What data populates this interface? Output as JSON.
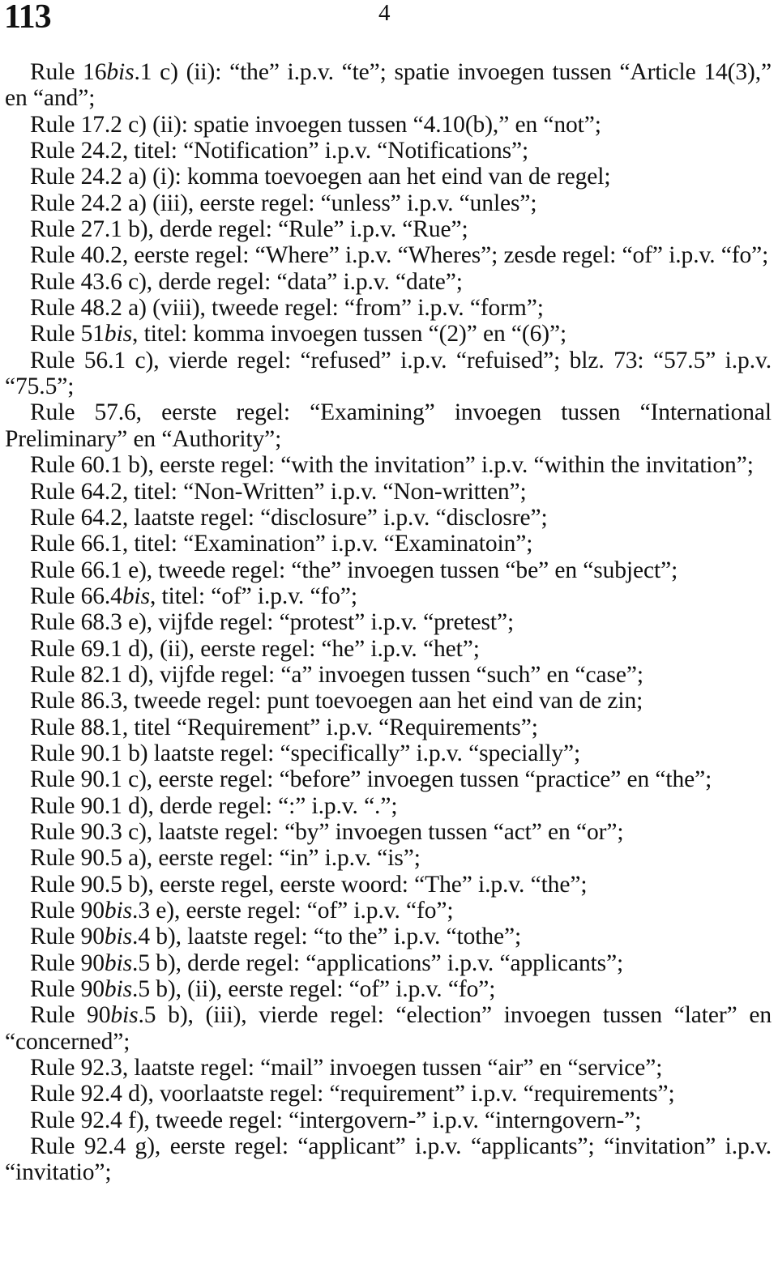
{
  "header": {
    "document_number": "113",
    "page_number": "4"
  },
  "errata": [
    {
      "rule": "Rule 16",
      "rule_bis": "bis",
      "rule_tail": ".1 c) (ii): “the” i.p.v. “te”; spatie invoegen tussen “Article 14(3),” en “and”;"
    },
    {
      "rule": "Rule 17.2 c) (ii): spatie invoegen tussen “4.10(b),” en “not”;"
    },
    {
      "rule": "Rule 24.2, titel: “Notification” i.p.v. “Notifications”;"
    },
    {
      "rule": "Rule 24.2 a) (i): komma toevoegen aan het eind van de regel;"
    },
    {
      "rule": "Rule 24.2 a) (iii), eerste regel: “unless” i.p.v. “unles”;"
    },
    {
      "rule": "Rule 27.1 b), derde regel: “Rule” i.p.v. “Rue”;"
    },
    {
      "rule": "Rule 40.2, eerste regel: “Where” i.p.v. “Wheres”; zesde regel: “of” i.p.v. “fo”;"
    },
    {
      "rule": "Rule 43.6 c), derde regel: “data” i.p.v. “date”;"
    },
    {
      "rule": "Rule 48.2 a) (viii), tweede regel: “from” i.p.v. “form”;"
    },
    {
      "rule": "Rule 51",
      "rule_bis": "bis",
      "rule_tail": ", titel: komma invoegen tussen “(2)” en “(6)”;"
    },
    {
      "rule": "Rule 56.1 c), vierde regel: “refused” i.p.v. “refuised”; blz. 73: “57.5” i.p.v. “75.5”;"
    },
    {
      "rule": "Rule 57.6, eerste regel: “Examining” invoegen tussen “International Preliminary” en “Authority”;"
    },
    {
      "rule": "Rule 60.1 b), eerste regel: “with the invitation” i.p.v. “within the invi­tation”;"
    },
    {
      "rule": "Rule 64.2, titel: “Non-Written” i.p.v. “Non-written”;"
    },
    {
      "rule": "Rule 64.2, laatste regel: “disclosure” i.p.v. “disclosre”;"
    },
    {
      "rule": "Rule 66.1, titel: “Examination” i.p.v. “Examinatoin”;"
    },
    {
      "rule": "Rule 66.1 e), tweede regel: “the” invoegen tussen “be” en “subject”;"
    },
    {
      "rule": "Rule 66.4",
      "rule_bis": "bis",
      "rule_tail": ", titel: “of” i.p.v. “fo”;"
    },
    {
      "rule": "Rule 68.3 e), vijfde regel: “protest” i.p.v. “pretest”;"
    },
    {
      "rule": "Rule 69.1 d), (ii), eerste regel: “he” i.p.v. “het”;"
    },
    {
      "rule": "Rule 82.1 d), vijfde regel: “a” invoegen tussen “such” en “case”;"
    },
    {
      "rule": "Rule 86.3, tweede regel: punt toevoegen aan het eind van de zin;"
    },
    {
      "rule": "Rule 88.1, titel “Requirement” i.p.v. “Requirements”;"
    },
    {
      "rule": "Rule 90.1 b) laatste regel: “specifically” i.p.v. “specially”;"
    },
    {
      "rule": "Rule 90.1 c), eerste regel: “before” invoegen tussen “practice” en “the”;"
    },
    {
      "rule": "Rule 90.1 d), derde regel: “:” i.p.v. “.”;"
    },
    {
      "rule": "Rule 90.3 c), laatste regel: “by” invoegen tussen “act” en “or”;"
    },
    {
      "rule": "Rule 90.5 a), eerste regel: “in” i.p.v. “is”;"
    },
    {
      "rule": "Rule 90.5 b), eerste regel, eerste woord: “The” i.p.v. “the”;"
    },
    {
      "rule": "Rule 90",
      "rule_bis": "bis",
      "rule_tail": ".3 e), eerste regel: “of” i.p.v. “fo”;"
    },
    {
      "rule": "Rule 90",
      "rule_bis": "bis",
      "rule_tail": ".4 b), laatste regel: “to the” i.p.v. “tothe”;"
    },
    {
      "rule": "Rule 90",
      "rule_bis": "bis",
      "rule_tail": ".5 b), derde regel: “applications” i.p.v. “applicants”;"
    },
    {
      "rule": "Rule 90",
      "rule_bis": "bis",
      "rule_tail": ".5 b), (ii), eerste regel: “of” i.p.v. “fo”;"
    },
    {
      "rule": "Rule 90",
      "rule_bis": "bis",
      "rule_tail": ".5 b), (iii), vierde regel: “election” invoegen tussen “later” en “concerned”;"
    },
    {
      "rule": "Rule 92.3, laatste regel: “mail” invoegen tussen “air” en “service”;"
    },
    {
      "rule": "Rule 92.4 d), voorlaatste regel: “requirement” i.p.v. “requirements”;"
    },
    {
      "rule": "Rule 92.4 f), tweede regel: “intergovern-” i.p.v. “interngovern-”;"
    },
    {
      "rule": "Rule 92.4 g), eerste regel: “applicant” i.p.v. “applicants”; “invita­tion” i.p.v. “invitatio”;"
    }
  ]
}
